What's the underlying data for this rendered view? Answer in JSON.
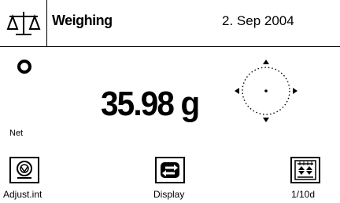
{
  "header": {
    "title": "Weighing",
    "date": "2. Sep 2004",
    "balance_icon": "balance-scale-icon"
  },
  "display": {
    "stability_indicator": "O",
    "weight": "35.98 g",
    "net_label": "Net",
    "level_indicator_icon": "level-circle-icon"
  },
  "softkeys": [
    {
      "label": "Adjust.int",
      "icon": "adjust-internal-icon"
    },
    {
      "label": "Display",
      "icon": "display-toggle-icon"
    },
    {
      "label": "1/10d",
      "icon": "readability-icon"
    }
  ]
}
